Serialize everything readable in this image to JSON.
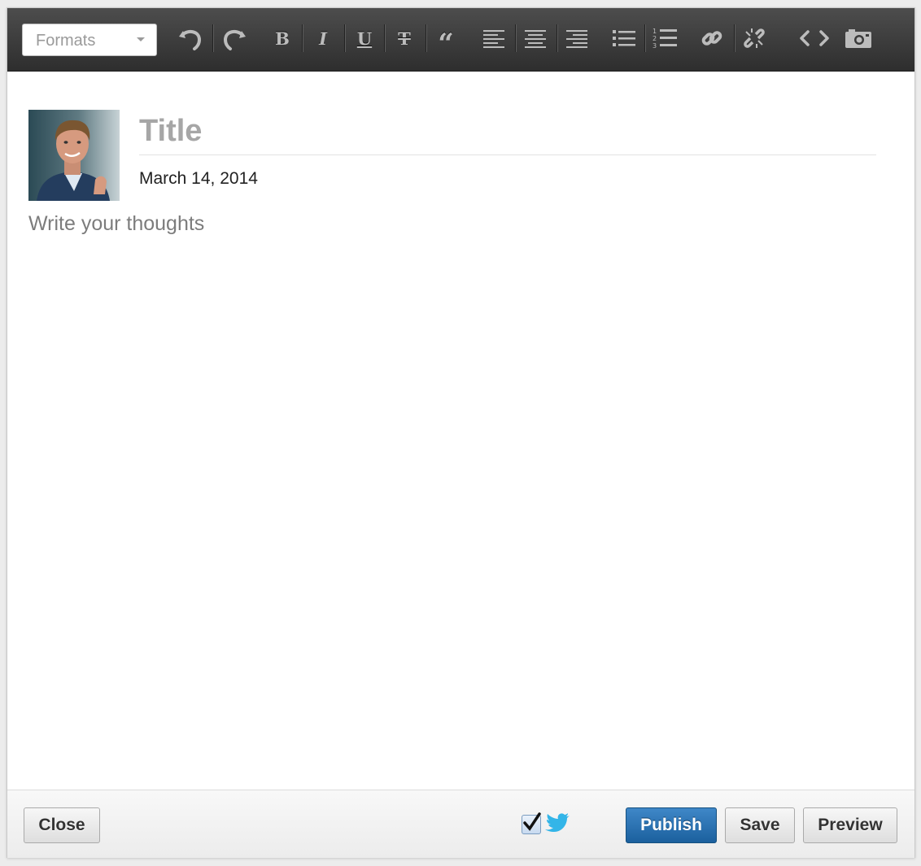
{
  "toolbar": {
    "formats_label": "Formats",
    "buttons": [
      {
        "name": "undo-icon"
      },
      {
        "name": "redo-icon"
      },
      {
        "name": "bold-icon",
        "glyph": "B"
      },
      {
        "name": "italic-icon",
        "glyph": "I"
      },
      {
        "name": "underline-icon",
        "glyph": "U"
      },
      {
        "name": "strikethrough-icon",
        "glyph": "T"
      },
      {
        "name": "quote-icon",
        "glyph": "“"
      },
      {
        "name": "align-left-icon"
      },
      {
        "name": "align-center-icon"
      },
      {
        "name": "align-right-icon"
      },
      {
        "name": "bullet-list-icon"
      },
      {
        "name": "numbered-list-icon"
      },
      {
        "name": "link-icon"
      },
      {
        "name": "unlink-icon"
      },
      {
        "name": "code-icon"
      },
      {
        "name": "camera-icon"
      }
    ]
  },
  "post": {
    "title_placeholder": "Title",
    "date": "March 14, 2014",
    "body_placeholder": "Write your thoughts"
  },
  "footer": {
    "close_label": "Close",
    "twitter_share_checked": true,
    "publish_label": "Publish",
    "save_label": "Save",
    "preview_label": "Preview"
  },
  "colors": {
    "toolbar_bg": "#3a3a3a",
    "publish_blue": "#2a72b5",
    "twitter_blue": "#33b5e8"
  }
}
